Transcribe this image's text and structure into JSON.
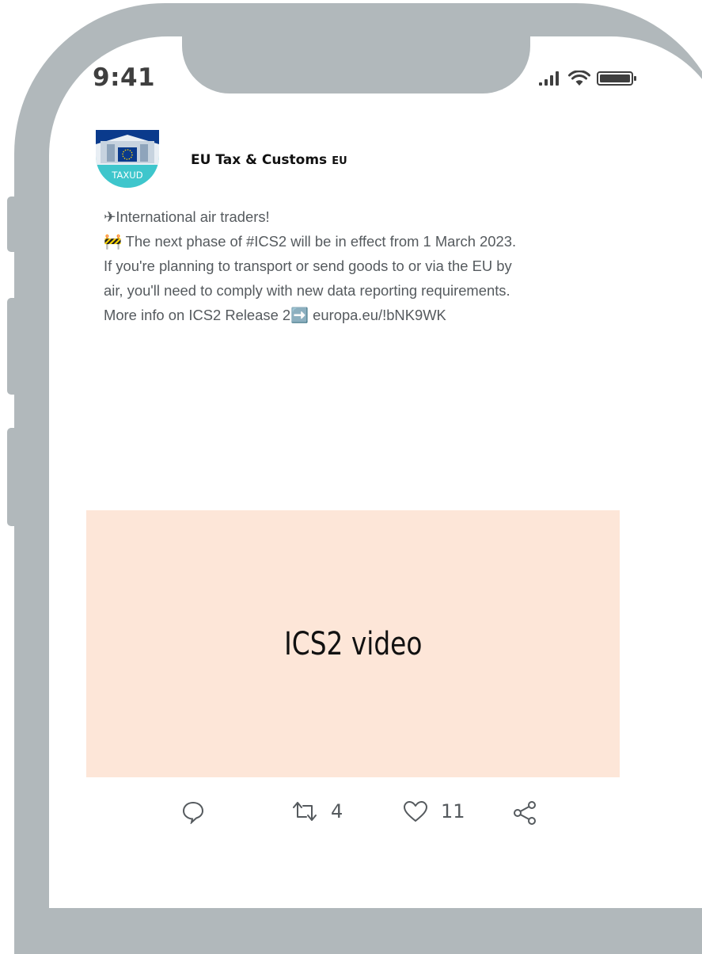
{
  "status_bar": {
    "time": "9:41"
  },
  "tweet": {
    "avatar_label": "TAXUD",
    "author": "EU Tax & Customs",
    "author_region": "EU",
    "lines": [
      "✈International air traders!",
      "🚧 The next phase of #ICS2 will be in effect from 1 March 2023.",
      "If you're planning to transport or send goods to or via the EU by",
      "air, you'll need to comply with new data reporting requirements.",
      "More info on ICS2 Release 2➡️ europa.eu/!bNK9WK"
    ],
    "media_label": "ICS2 video"
  },
  "actions": {
    "retweet_count": "4",
    "like_count": "11"
  },
  "colors": {
    "frame": "#b1b8bb",
    "media_bg": "#fde6d8",
    "avatar_teal": "#3ec6cc",
    "avatar_blue": "#0a3a8c",
    "text": "#555a5e"
  }
}
